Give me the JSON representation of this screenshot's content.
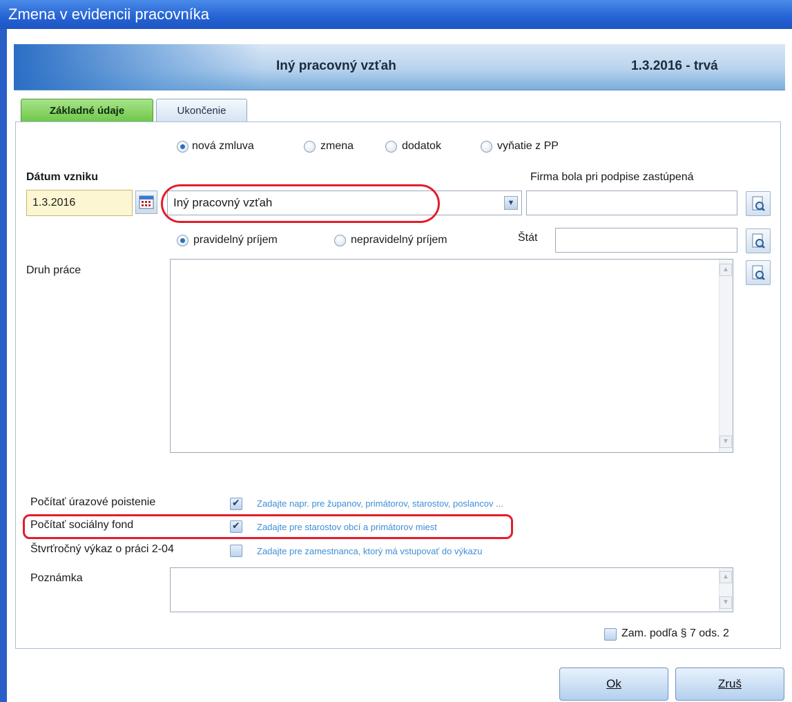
{
  "window": {
    "title": "Zmena v evidencii pracovníka"
  },
  "header": {
    "title": "Iný pracovný vzťah",
    "period": "1.3.2016 - trvá"
  },
  "tabs": [
    {
      "label": "Základné údaje",
      "active": true
    },
    {
      "label": "Ukončenie",
      "active": false
    }
  ],
  "contract_type_radios": [
    {
      "label": "nová zmluva",
      "selected": true
    },
    {
      "label": "zmena",
      "selected": false
    },
    {
      "label": "dodatok",
      "selected": false
    },
    {
      "label": "vyňatie z PP",
      "selected": false
    }
  ],
  "datum_vzniku": {
    "label": "Dátum vzniku",
    "value": "1.3.2016"
  },
  "relation_combo": {
    "value": "Iný pracovný vzťah"
  },
  "firma": {
    "label": "Firma bola pri podpise zastúpená",
    "value": ""
  },
  "income_radios": [
    {
      "label": "pravidelný príjem",
      "selected": true
    },
    {
      "label": "nepravidelný príjem",
      "selected": false
    }
  ],
  "stat": {
    "label": "Štát",
    "value": ""
  },
  "druh_prace": {
    "label": "Druh práce",
    "value": ""
  },
  "options": [
    {
      "label": "Počítať úrazové poistenie",
      "checked": true,
      "hint": "Zadajte napr. pre županov, primátorov, starostov, poslancov ..."
    },
    {
      "label": "Počítať sociálny fond",
      "checked": true,
      "hint": "Zadajte pre starostov obcí a primátorov miest"
    },
    {
      "label": "Štvrťročný výkaz o práci 2-04",
      "checked": false,
      "hint": "Zadajte pre zamestnanca, ktorý má vstupovať do výkazu"
    }
  ],
  "poznamka": {
    "label": "Poznámka",
    "value": ""
  },
  "zam_checkbox": {
    "label": "Zam. podľa § 7 ods. 2",
    "checked": false
  },
  "buttons": {
    "ok": "Ok",
    "cancel": "Zruš"
  },
  "colors": {
    "highlight": "#e31c2a",
    "hint": "#3d8fd6",
    "active_tab": "#6fc84a",
    "date_field": "#fcf6d2"
  }
}
